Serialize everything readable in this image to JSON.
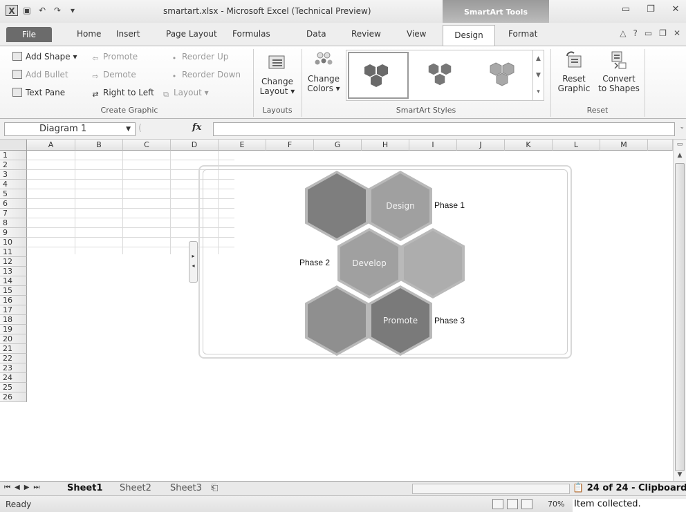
{
  "window": {
    "title": "smartart.xlsx - Microsoft Excel (Technical Preview)",
    "contextual_group": "SmartArt Tools",
    "logo": "X"
  },
  "tabs": {
    "file": "File",
    "home": "Home",
    "insert": "Insert",
    "page_layout": "Page Layout",
    "formulas": "Formulas",
    "data": "Data",
    "review": "Review",
    "view": "View",
    "design": "Design",
    "format": "Format"
  },
  "ribbon": {
    "create_graphic": {
      "label": "Create Graphic",
      "add_shape": "Add Shape ▾",
      "add_bullet": "Add Bullet",
      "text_pane": "Text Pane",
      "promote": "Promote",
      "demote": "Demote",
      "right_to_left": "Right to Left",
      "reorder_up": "Reorder Up",
      "reorder_down": "Reorder Down",
      "layout": "Layout ▾"
    },
    "layouts": {
      "label": "Layouts",
      "change_layout_1": "Change",
      "change_layout_2": "Layout ▾"
    },
    "smartart_styles": {
      "label": "SmartArt Styles",
      "change_colors_1": "Change",
      "change_colors_2": "Colors ▾"
    },
    "reset": {
      "label": "Reset",
      "reset_graphic_1": "Reset",
      "reset_graphic_2": "Graphic",
      "convert_1": "Convert",
      "convert_2": "to Shapes"
    }
  },
  "formula_bar": {
    "name_box": "Diagram 1",
    "fx": "fx",
    "value": ""
  },
  "grid": {
    "columns": [
      "A",
      "B",
      "C",
      "D",
      "E",
      "F",
      "G",
      "H",
      "I",
      "J",
      "K",
      "L",
      "M"
    ],
    "rows": [
      "1",
      "2",
      "3",
      "4",
      "5",
      "6",
      "7",
      "8",
      "9",
      "10",
      "11",
      "12",
      "13",
      "14",
      "15",
      "16",
      "17",
      "18",
      "19",
      "20",
      "21",
      "22",
      "23",
      "24",
      "25",
      "26"
    ]
  },
  "smartart": {
    "shapes": [
      {
        "text": "",
        "color": "#7e7e7e"
      },
      {
        "text": "Design",
        "color": "#a0a0a0"
      },
      {
        "text": "Develop",
        "color": "#a0a0a0"
      },
      {
        "text": "",
        "color": "#adadad"
      },
      {
        "text": "",
        "color": "#8f8f8f"
      },
      {
        "text": "Promote",
        "color": "#7a7a7a"
      }
    ],
    "labels": {
      "phase1": "Phase 1",
      "phase2": "Phase 2",
      "phase3": "Phase 3"
    }
  },
  "sheets": {
    "tabs": [
      "Sheet1",
      "Sheet2",
      "Sheet3"
    ],
    "active": "Sheet1"
  },
  "clipboard": {
    "count": "24 of 24 - Clipboard",
    "message": "Item collected."
  },
  "status": {
    "ready": "Ready",
    "zoom": "70%"
  }
}
